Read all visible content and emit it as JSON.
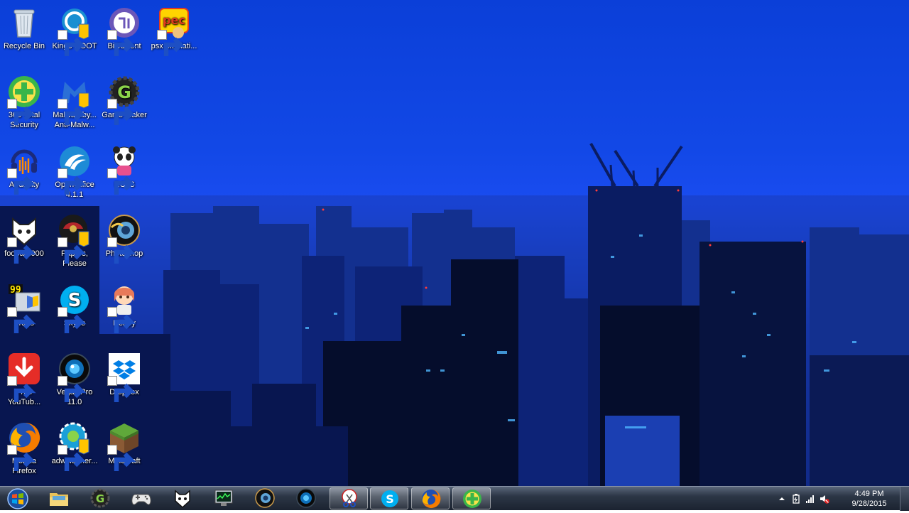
{
  "desktop": {
    "icons": [
      {
        "label": "Recycle Bin",
        "icon": "recycle-bin-icon",
        "shortcut": false
      },
      {
        "label": "Kingo ROOT",
        "icon": "kingo-root-icon",
        "shortcut": true
      },
      {
        "label": "BitTorrent",
        "icon": "bittorrent-icon",
        "shortcut": true
      },
      {
        "label": "psx emulati...",
        "icon": "psx-emulator-icon",
        "shortcut": true
      },
      {
        "label": "360 Total Security",
        "icon": "360-total-security-icon",
        "shortcut": true
      },
      {
        "label": "Malwareby... Anti-Malw...",
        "icon": "malwarebytes-icon",
        "shortcut": true
      },
      {
        "label": "Game Maker",
        "icon": "game-maker-icon",
        "shortcut": true
      },
      {
        "label": "Audacity",
        "icon": "audacity-icon",
        "shortcut": true
      },
      {
        "label": "OpenOffice 4.1.1",
        "icon": "openoffice-icon",
        "shortcut": true
      },
      {
        "label": "RCT3",
        "icon": "rct3-icon",
        "shortcut": true
      },
      {
        "label": "foobar2000",
        "icon": "foobar2000-icon",
        "shortcut": true
      },
      {
        "label": "Papers, Please",
        "icon": "papers-please-icon",
        "shortcut": true
      },
      {
        "label": "Photoshop",
        "icon": "photoshop-icon",
        "shortcut": true
      },
      {
        "label": "Fraps",
        "icon": "fraps-icon",
        "shortcut": true
      },
      {
        "label": "Skype",
        "icon": "skype-icon",
        "shortcut": true
      },
      {
        "label": "Renpy",
        "icon": "renpy-icon",
        "shortcut": true
      },
      {
        "label": "Free YouTub...",
        "icon": "free-youtube-downloader-icon",
        "shortcut": true
      },
      {
        "label": "Vegas Pro 11.0",
        "icon": "vegas-pro-icon",
        "shortcut": true
      },
      {
        "label": "Dropbox",
        "icon": "dropbox-icon",
        "shortcut": true
      },
      {
        "label": "Mozilla Firefox",
        "icon": "firefox-icon",
        "shortcut": true
      },
      {
        "label": "adwcleaner...",
        "icon": "adwcleaner-icon",
        "shortcut": true
      },
      {
        "label": "Minecraft",
        "icon": "minecraft-icon",
        "shortcut": true
      }
    ]
  },
  "taskbar": {
    "start": {
      "icon": "windows-start-icon"
    },
    "items": [
      {
        "icon": "windows-explorer-icon",
        "open": false
      },
      {
        "icon": "game-maker-icon",
        "open": false
      },
      {
        "icon": "gamepad-icon",
        "open": false
      },
      {
        "icon": "foobar2000-icon",
        "open": false
      },
      {
        "icon": "task-manager-icon",
        "open": false
      },
      {
        "icon": "photoshop-icon",
        "open": false
      },
      {
        "icon": "vegas-pro-icon",
        "open": false
      },
      {
        "icon": "snipping-tool-icon",
        "open": true
      },
      {
        "icon": "skype-icon",
        "open": true
      },
      {
        "icon": "firefox-icon",
        "open": true
      },
      {
        "icon": "360-total-security-icon",
        "open": true
      }
    ],
    "tray": {
      "icons": [
        "show-hidden-icons-icon",
        "power-icon",
        "network-signal-icon",
        "volume-muted-icon"
      ],
      "time": "4:49 PM",
      "date": "9/28/2015"
    }
  },
  "colors": {
    "wallpaper_sky": "#1248e6",
    "taskbar": "#1b2330"
  }
}
